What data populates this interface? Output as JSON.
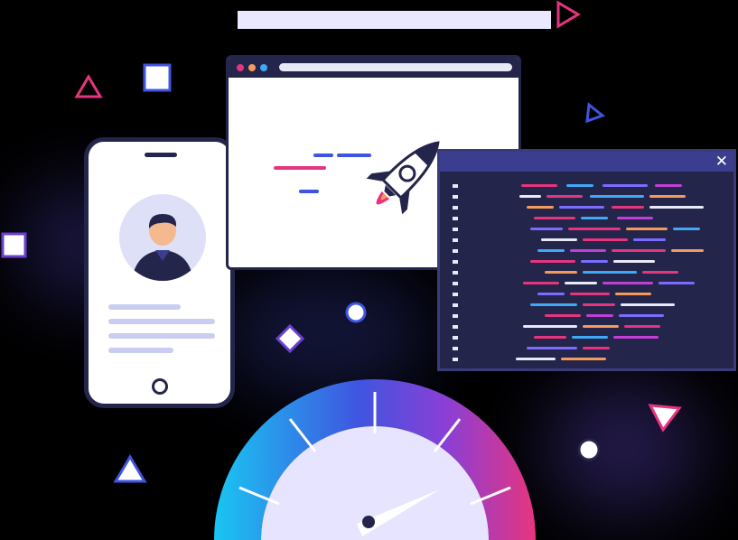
{
  "illustration": {
    "theme": "web-speed-optimization",
    "colors": {
      "navy": "#24254a",
      "indigo": "#3b3d8f",
      "pink": "#e6357f",
      "blue": "#3f55e0",
      "cyan": "#19c6f2",
      "lavender": "#dde0f7"
    }
  },
  "code_window": {
    "close_glyph": "✕"
  },
  "icons": [
    "rocket-icon",
    "user-avatar-icon",
    "speedometer-icon",
    "close-icon"
  ]
}
